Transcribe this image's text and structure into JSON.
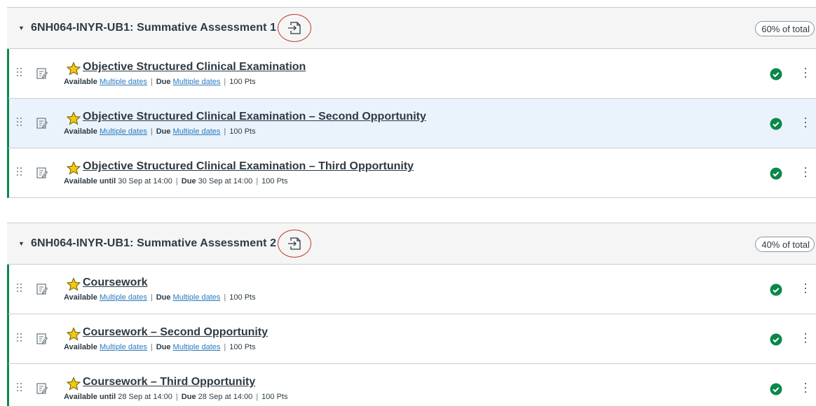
{
  "colors": {
    "published": "#0b874b",
    "link": "#2b7abc",
    "star": "#f2c811",
    "highlight": "#eaf3fb",
    "circle": "#c0392b"
  },
  "groups": [
    {
      "caret": "▼",
      "title": "6NH064-INYR-UB1: Summative Assessment 1",
      "weight": "60% of total",
      "items": [
        {
          "title": "Objective Structured Clinical Examination",
          "avail_label": "Available",
          "avail_value": "Multiple dates",
          "avail_link": true,
          "due_label": "Due",
          "due_value": "Multiple dates",
          "due_link": true,
          "points": "100 Pts",
          "highlight": false
        },
        {
          "title": "Objective Structured Clinical Examination – Second Opportunity",
          "avail_label": "Available",
          "avail_value": "Multiple dates",
          "avail_link": true,
          "due_label": "Due",
          "due_value": "Multiple dates",
          "due_link": true,
          "points": "100 Pts",
          "highlight": true
        },
        {
          "title": "Objective Structured Clinical Examination – Third Opportunity",
          "avail_label": "Available until",
          "avail_value": "30 Sep at 14:00",
          "avail_link": false,
          "due_label": "Due",
          "due_value": "30 Sep at 14:00",
          "due_link": false,
          "points": "100 Pts",
          "highlight": false
        }
      ]
    },
    {
      "caret": "▼",
      "title": "6NH064-INYR-UB1: Summative Assessment 2",
      "weight": "40% of total",
      "items": [
        {
          "title": "Coursework",
          "avail_label": "Available",
          "avail_value": "Multiple dates",
          "avail_link": true,
          "due_label": "Due",
          "due_value": "Multiple dates",
          "due_link": true,
          "points": "100 Pts",
          "highlight": false
        },
        {
          "title": "Coursework – Second Opportunity",
          "avail_label": "Available",
          "avail_value": "Multiple dates",
          "avail_link": true,
          "due_label": "Due",
          "due_value": "Multiple dates",
          "due_link": true,
          "points": "100 Pts",
          "highlight": false
        },
        {
          "title": "Coursework – Third Opportunity",
          "avail_label": "Available until",
          "avail_value": "28 Sep at 14:00",
          "avail_link": false,
          "due_label": "Due",
          "due_value": "28 Sep at 14:00",
          "due_link": false,
          "points": "100 Pts",
          "highlight": false
        }
      ]
    }
  ],
  "icons": {
    "caret": "caret-down-icon",
    "export": "export-icon",
    "drag": "drag-handle-icon",
    "assignment": "assignment-icon",
    "star": "star-icon",
    "published": "published-check-icon",
    "menu": "kebab-menu-icon"
  }
}
